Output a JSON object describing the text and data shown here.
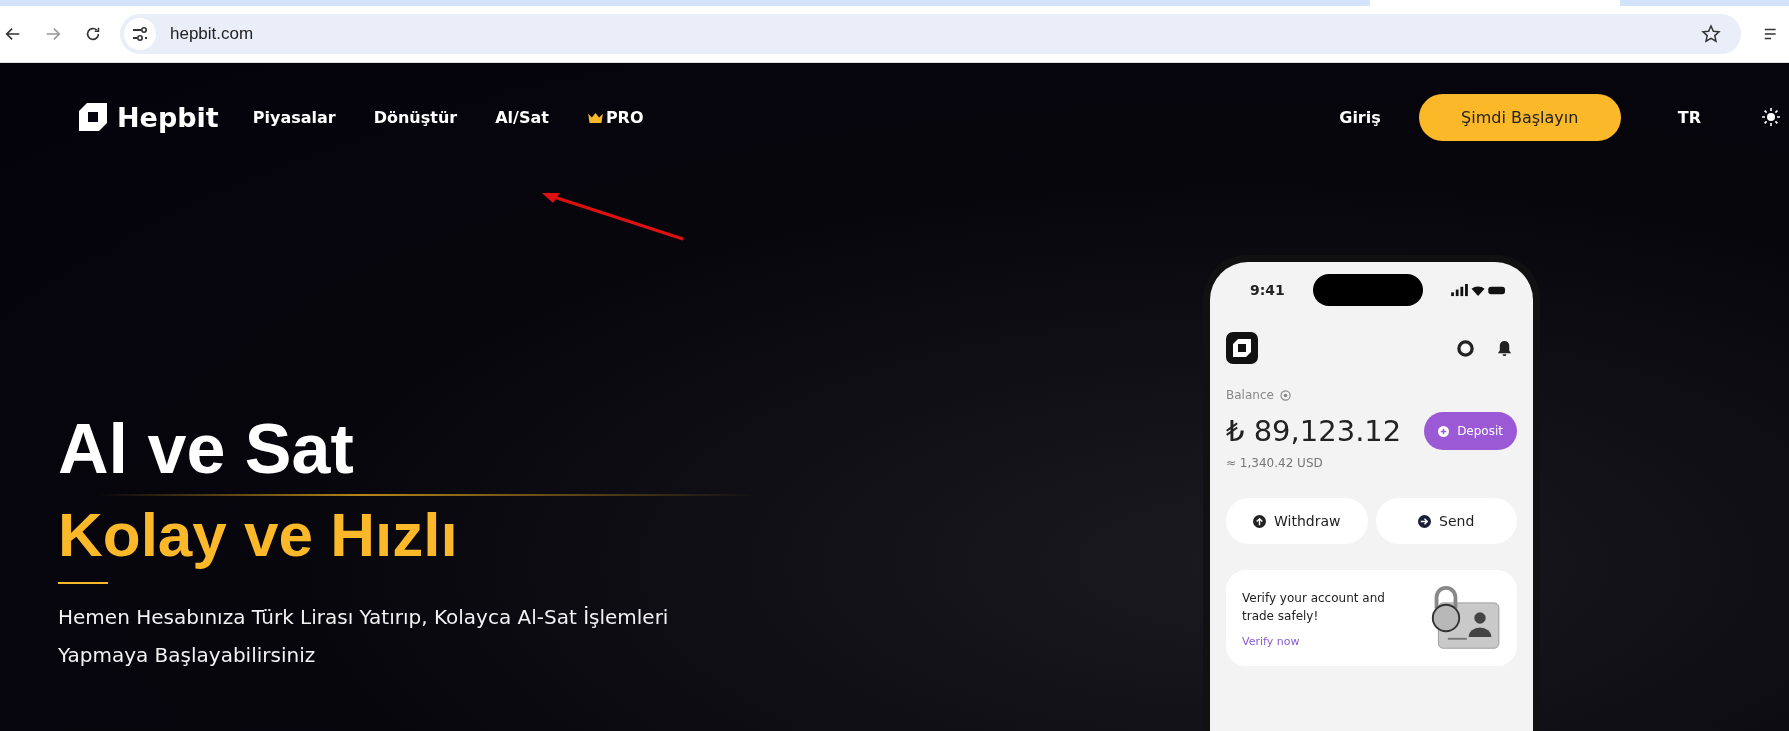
{
  "browser": {
    "url": "hepbit.com"
  },
  "nav": {
    "logo": "Hepbit",
    "links": [
      {
        "label": "Piyasalar",
        "kind": "plain"
      },
      {
        "label": "Dönüştür",
        "kind": "plain"
      },
      {
        "label": "Al/Sat",
        "kind": "plain"
      },
      {
        "label": "PRO",
        "kind": "pro"
      }
    ],
    "login": "Giriş",
    "cta": "Şimdi Başlayın",
    "language": "TR"
  },
  "hero": {
    "title": "Al ve Sat",
    "subtitle": "Kolay ve Hızlı",
    "description": "Hemen Hesabınıza Türk Lirası Yatırıp, Kolayca Al-Sat İşlemleri Yapmaya Başlayabilirsiniz"
  },
  "phone": {
    "time": "9:41",
    "balance_label": "Balance",
    "balance": "₺ 89,123.12",
    "balance_usd": "≈ 1,340.42 USD",
    "deposit": "Deposit",
    "actions": [
      {
        "label": "Withdraw",
        "kind": "up"
      },
      {
        "label": "Send",
        "kind": "right"
      }
    ],
    "verify": {
      "text": "Verify your account and trade safely!",
      "link": "Verify now"
    }
  }
}
